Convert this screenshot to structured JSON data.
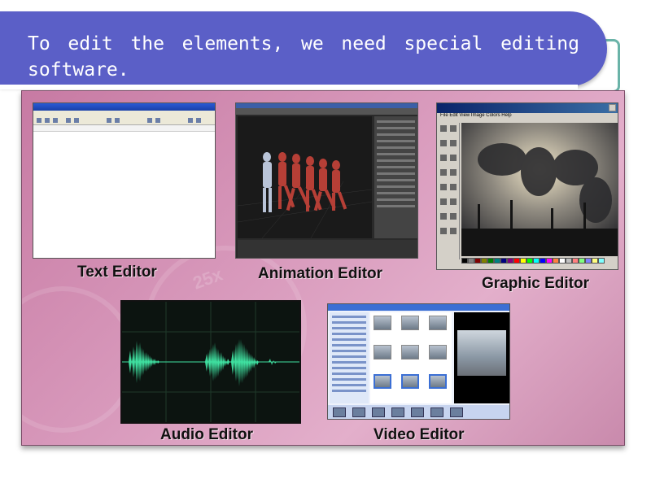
{
  "slide": {
    "heading": "To edit the elements, we need special editing software.",
    "watermark": "25x"
  },
  "editors": [
    {
      "caption": "Text Editor",
      "icon": "text-editor-screenshot"
    },
    {
      "caption": "Animation Editor",
      "icon": "animation-editor-screenshot"
    },
    {
      "caption": "Graphic Editor",
      "icon": "graphic-editor-screenshot"
    },
    {
      "caption": "Audio Editor",
      "icon": "audio-waveform-screenshot"
    },
    {
      "caption": "Video Editor",
      "icon": "video-editor-screenshot"
    }
  ],
  "graphic_editor": {
    "menu": "File  Edit  View  Image  Colors  Help"
  },
  "colors": {
    "banner": "#5b5fc7",
    "panel": "#d99bbd",
    "waveform": "#3fe0a0"
  }
}
